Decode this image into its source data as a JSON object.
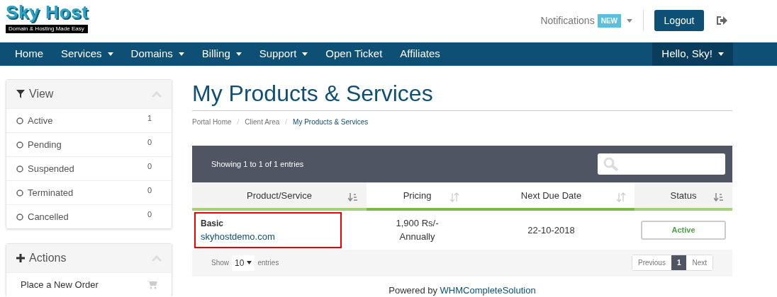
{
  "logo": {
    "title": "Sky Host",
    "tagline": "Domain & Hosting Made Easy"
  },
  "topbar": {
    "notifications": "Notifications",
    "badge": "NEW",
    "logout": "Logout"
  },
  "nav": {
    "items": [
      {
        "label": "Home",
        "dropdown": false
      },
      {
        "label": "Services",
        "dropdown": true
      },
      {
        "label": "Domains",
        "dropdown": true
      },
      {
        "label": "Billing",
        "dropdown": true
      },
      {
        "label": "Support",
        "dropdown": true
      },
      {
        "label": "Open Ticket",
        "dropdown": false
      },
      {
        "label": "Affiliates",
        "dropdown": false
      }
    ],
    "user": "Hello, Sky!"
  },
  "sidebar": {
    "view": {
      "title": "View",
      "items": [
        {
          "label": "Active",
          "count": "1"
        },
        {
          "label": "Pending",
          "count": "0"
        },
        {
          "label": "Suspended",
          "count": "0"
        },
        {
          "label": "Terminated",
          "count": "0"
        },
        {
          "label": "Cancelled",
          "count": "0"
        }
      ]
    },
    "actions": {
      "title": "Actions",
      "items": [
        {
          "label": "Place a New Order"
        }
      ]
    }
  },
  "page": {
    "title": "My Products & Services",
    "separator": "/",
    "breadcrumb": [
      {
        "label": "Portal Home",
        "current": false
      },
      {
        "label": "Client Area",
        "current": false
      },
      {
        "label": "My Products & Services",
        "current": true
      }
    ]
  },
  "table": {
    "info": "Showing 1 to 1 of 1 entries",
    "columns": [
      {
        "label": "Product/Service",
        "sorted": true
      },
      {
        "label": "Pricing",
        "sorted": false
      },
      {
        "label": "Next Due Date",
        "sorted": false
      },
      {
        "label": "Status",
        "sorted": true
      }
    ],
    "rows": [
      {
        "product": "Basic",
        "domain": "skyhostdemo.com",
        "price": "1,900 Rs/-",
        "cycle": "Annually",
        "due": "22-10-2018",
        "status": "Active",
        "highlighted": true
      }
    ],
    "show": "Show",
    "page_size": "10",
    "entries": "entries",
    "pagination": [
      {
        "label": "Previous",
        "selected": false
      },
      {
        "label": "1",
        "selected": true
      },
      {
        "label": "Next",
        "selected": false
      }
    ]
  },
  "footer": {
    "prefix": "Powered by",
    "link": "WHMCompleteSolution"
  }
}
